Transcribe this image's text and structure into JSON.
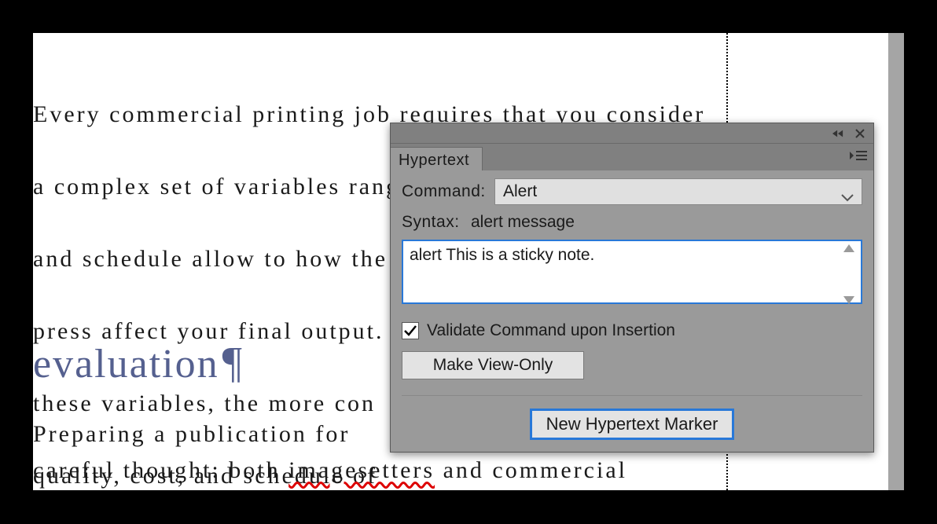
{
  "document": {
    "para1_line1": "   Every commercial printing job requires that you consider",
    "para1_line2": "a complex set of variables ranging from what your budget",
    "para1_line3": "and schedule allow to how the ",
    "para1_line4": "press affect your final output. ",
    "para1_line5": "these variables, the more con",
    "para1_line6": "quality, cost, and schedule of ",
    "heading": "evaluation",
    "pilcrow": "¶",
    "para2_line1": "   Preparing a publication for ",
    "para2_line2_a": "careful thought: both ",
    "para2_misspelled": "imagesetters",
    "para2_line2_b": " and commercial"
  },
  "panel": {
    "title": "Hypertext",
    "command_label": "Command:",
    "command_value": "Alert",
    "syntax_label": "Syntax:",
    "syntax_value": "alert message",
    "textarea_value": "alert This is a sticky note.",
    "validate_label": "Validate Command upon Insertion",
    "make_view_only": "Make View-Only",
    "primary_button": "New Hypertext Marker"
  }
}
